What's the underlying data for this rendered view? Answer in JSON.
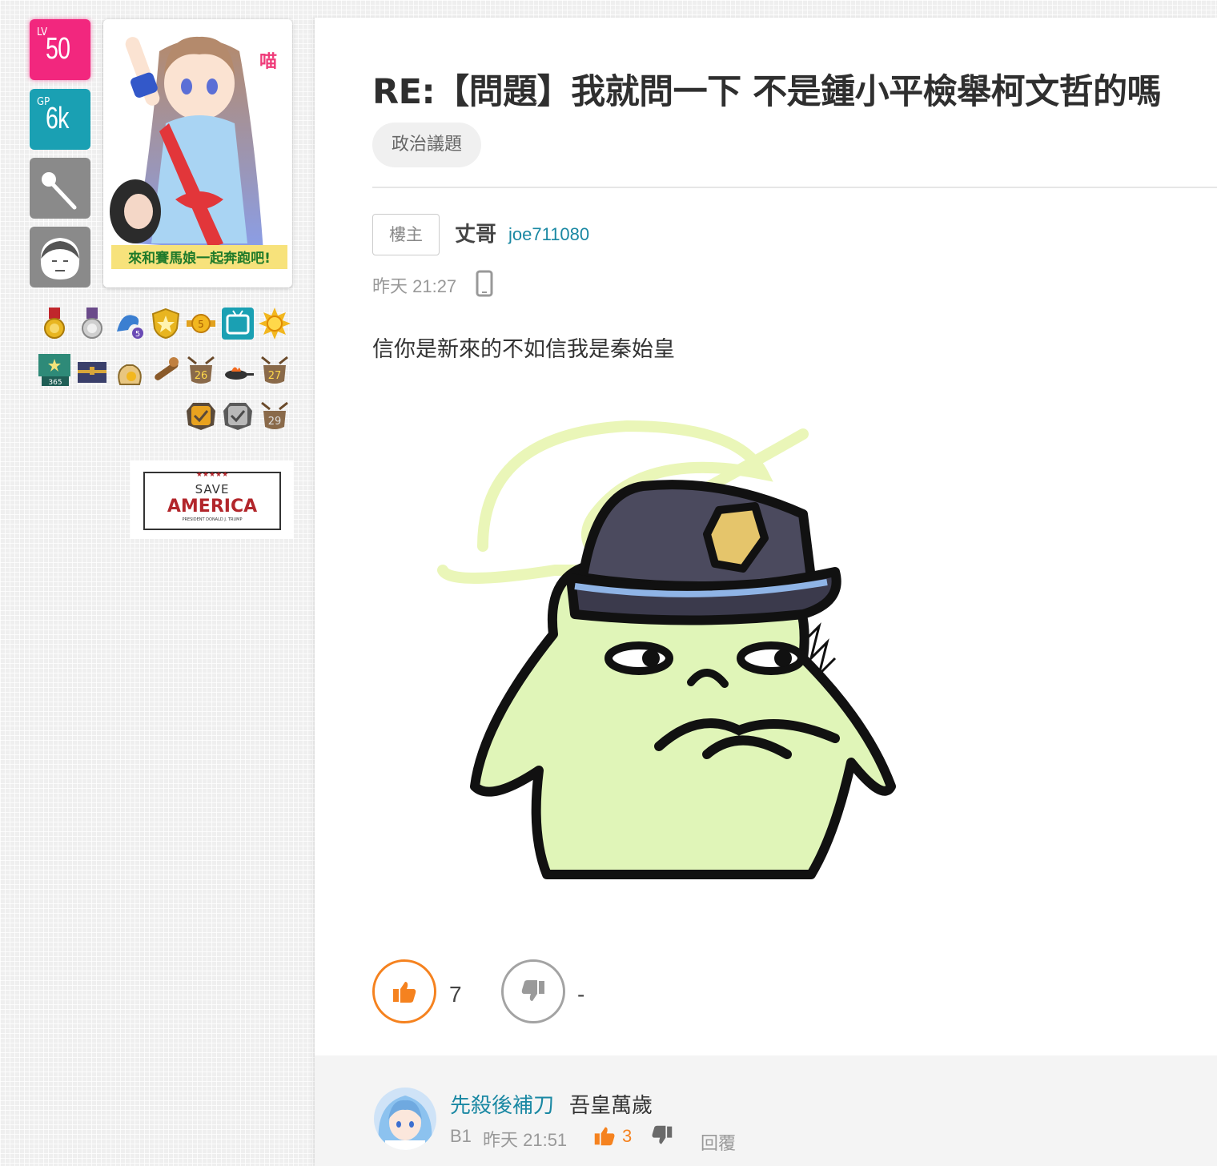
{
  "profile": {
    "level_label": "LV",
    "level_value": "50",
    "gp_label": "GP",
    "gp_value": "6k"
  },
  "avatar_banner_text": "來和賽馬娘一起奔跑吧!",
  "badges": [
    "gold-medal-icon",
    "silver-medal-icon",
    "dragon-5-icon",
    "star-shield-icon",
    "coin-5-icon",
    "tv-screen-icon",
    "sun-icon",
    "flag-365-icon",
    "treasure-chest-icon",
    "money-bag-icon",
    "slingshot-icon",
    "level-26-icon",
    "frying-pan-icon",
    "level-27-icon",
    "checkmark-gold-icon",
    "checkmark-silver-icon",
    "level-29-icon"
  ],
  "sidebar_ad": {
    "stars": "★★★★★",
    "line1": "SAVE",
    "line2": "AMERICA",
    "line3": "PRESIDENT DONALD J. TRUMP"
  },
  "post": {
    "title": "RE:【問題】我就問一下 不是鍾小平檢舉柯文哲的嗎",
    "tag": "政治議題",
    "floor_tag": "樓主",
    "author_name": "丈哥",
    "author_id": "joe711080",
    "time": "昨天 21:27",
    "body": "信你是新來的不如信我是秦始皇",
    "like_count": "7",
    "dislike_count": "-"
  },
  "comment": {
    "author": "先殺後補刀",
    "text": "吾皇萬歲",
    "floor": "B1",
    "time": "昨天 21:51",
    "like_count": "3",
    "reply_label": "回覆"
  },
  "colors": {
    "level_pink": "#f2277e",
    "gp_teal": "#1aa0b3",
    "accent_orange": "#f5821f",
    "link_teal": "#1a88a3"
  }
}
